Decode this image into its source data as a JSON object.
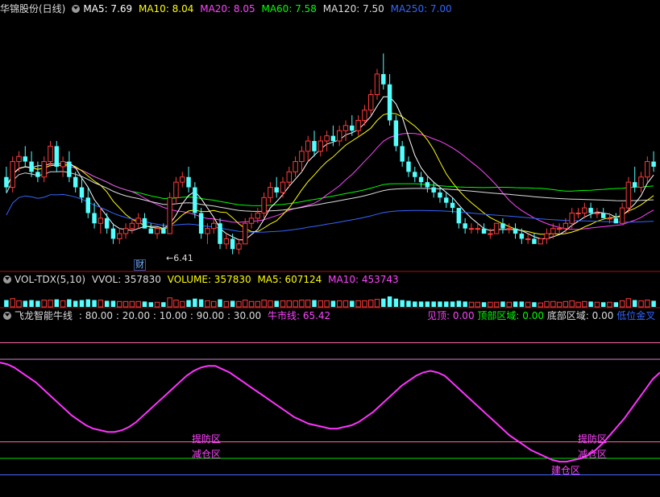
{
  "panel1": {
    "title": "华锦股份(日线)",
    "ma": [
      {
        "label": "MA5: 7.69",
        "color": "#ffffff"
      },
      {
        "label": "MA10: 8.04",
        "color": "#ffff00"
      },
      {
        "label": "MA20: 8.05",
        "color": "#ff44ff"
      },
      {
        "label": "MA60: 7.58",
        "color": "#00ff00"
      },
      {
        "label": "MA120: 7.50",
        "color": "#dddddd"
      },
      {
        "label": "MA250: 7.00",
        "color": "#3366ff"
      }
    ],
    "low_label": "6.41",
    "cai_label": "财"
  },
  "panel2": {
    "title": "VOL-TDX(5,10)",
    "items": [
      {
        "label": "VVOL: 357830",
        "color": "#dddddd"
      },
      {
        "label": "VOLUME: 357830",
        "color": "#ffff00"
      },
      {
        "label": "MA5: 607124",
        "color": "#ffff00"
      },
      {
        "label": "MA10: 453743",
        "color": "#ff44ff"
      }
    ]
  },
  "panel3": {
    "title": "飞龙智能牛线",
    "params": ": 80.00 : 20.00 : 10.00 : 90.00 : 30.00",
    "bull_label": "牛市线: 65.42",
    "right": [
      {
        "label": "见顶: 0.00",
        "color": "#ff44ff"
      },
      {
        "label": "顶部区域: 0.00",
        "color": "#00ff00"
      },
      {
        "label": "底部区域: 0.00",
        "color": "#dddddd"
      },
      {
        "label": "低位金叉",
        "color": "#3366ff"
      }
    ],
    "zone_labels": {
      "warn": "提防区",
      "hold": "减仓区",
      "build": "建仓区"
    }
  },
  "chart_data": {
    "type": "candlestick",
    "candles": [
      [
        7.9,
        8.1,
        7.6,
        7.7
      ],
      [
        7.7,
        8.3,
        7.6,
        8.2
      ],
      [
        8.2,
        8.4,
        8.0,
        8.3
      ],
      [
        8.3,
        8.5,
        8.1,
        8.2
      ],
      [
        8.2,
        8.4,
        7.9,
        8.0
      ],
      [
        8.0,
        8.2,
        7.8,
        7.9
      ],
      [
        7.9,
        8.3,
        7.8,
        8.2
      ],
      [
        8.2,
        8.6,
        8.1,
        8.5
      ],
      [
        8.5,
        8.6,
        8.0,
        8.1
      ],
      [
        8.1,
        8.3,
        7.9,
        8.2
      ],
      [
        8.2,
        8.4,
        7.8,
        7.9
      ],
      [
        7.9,
        8.0,
        7.6,
        7.7
      ],
      [
        7.7,
        7.9,
        7.4,
        7.5
      ],
      [
        7.5,
        7.7,
        7.1,
        7.2
      ],
      [
        7.2,
        7.4,
        6.9,
        7.0
      ],
      [
        7.0,
        7.3,
        6.8,
        7.1
      ],
      [
        7.1,
        7.2,
        6.8,
        6.9
      ],
      [
        6.9,
        7.0,
        6.6,
        6.7
      ],
      [
        6.7,
        6.9,
        6.6,
        6.8
      ],
      [
        6.8,
        7.0,
        6.7,
        6.9
      ],
      [
        6.9,
        7.1,
        6.8,
        7.0
      ],
      [
        7.0,
        7.2,
        6.9,
        7.1
      ],
      [
        7.1,
        7.2,
        6.9,
        6.9
      ],
      [
        6.9,
        7.0,
        6.8,
        6.8
      ],
      [
        6.8,
        6.9,
        6.7,
        6.9
      ],
      [
        6.9,
        7.0,
        6.8,
        6.8
      ],
      [
        6.8,
        7.6,
        6.8,
        7.5
      ],
      [
        7.5,
        7.9,
        7.4,
        7.8
      ],
      [
        7.8,
        8.0,
        7.7,
        7.9
      ],
      [
        7.9,
        8.1,
        7.6,
        7.7
      ],
      [
        7.7,
        7.8,
        7.1,
        7.2
      ],
      [
        7.2,
        7.3,
        6.7,
        6.8
      ],
      [
        6.8,
        7.0,
        6.6,
        6.9
      ],
      [
        6.9,
        7.1,
        6.8,
        7.0
      ],
      [
        7.0,
        7.1,
        6.5,
        6.6
      ],
      [
        6.6,
        6.8,
        6.5,
        6.7
      ],
      [
        6.7,
        6.8,
        6.4,
        6.5
      ],
      [
        6.5,
        6.7,
        6.4,
        6.6
      ],
      [
        6.6,
        7.1,
        6.6,
        7.0
      ],
      [
        7.0,
        7.2,
        6.9,
        7.1
      ],
      [
        7.1,
        7.3,
        7.0,
        7.2
      ],
      [
        7.2,
        7.6,
        7.1,
        7.5
      ],
      [
        7.5,
        7.8,
        7.4,
        7.7
      ],
      [
        7.7,
        7.9,
        7.5,
        7.6
      ],
      [
        7.6,
        7.9,
        7.5,
        7.8
      ],
      [
        7.8,
        8.1,
        7.7,
        8.0
      ],
      [
        8.0,
        8.3,
        7.9,
        8.2
      ],
      [
        8.2,
        8.5,
        8.0,
        8.4
      ],
      [
        8.4,
        8.7,
        8.2,
        8.6
      ],
      [
        8.6,
        8.8,
        8.3,
        8.4
      ],
      [
        8.4,
        8.7,
        8.3,
        8.6
      ],
      [
        8.6,
        8.8,
        8.4,
        8.7
      ],
      [
        8.7,
        8.9,
        8.5,
        8.6
      ],
      [
        8.6,
        8.9,
        8.5,
        8.8
      ],
      [
        8.8,
        9.0,
        8.6,
        8.9
      ],
      [
        8.9,
        9.1,
        8.7,
        8.8
      ],
      [
        8.8,
        9.1,
        8.7,
        9.0
      ],
      [
        9.0,
        9.3,
        8.9,
        9.2
      ],
      [
        9.2,
        9.6,
        9.1,
        9.5
      ],
      [
        9.5,
        10.0,
        9.4,
        9.9
      ],
      [
        9.9,
        10.3,
        9.6,
        9.7
      ],
      [
        9.7,
        9.9,
        8.9,
        9.0
      ],
      [
        9.0,
        9.1,
        8.4,
        8.5
      ],
      [
        8.5,
        8.6,
        8.1,
        8.2
      ],
      [
        8.2,
        8.3,
        7.9,
        8.0
      ],
      [
        8.0,
        8.1,
        7.8,
        7.9
      ],
      [
        7.9,
        8.0,
        7.7,
        7.8
      ],
      [
        7.8,
        7.9,
        7.6,
        7.7
      ],
      [
        7.7,
        7.8,
        7.5,
        7.6
      ],
      [
        7.6,
        7.7,
        7.4,
        7.5
      ],
      [
        7.5,
        7.6,
        7.3,
        7.4
      ],
      [
        7.4,
        7.5,
        7.2,
        7.3
      ],
      [
        7.3,
        7.3,
        6.9,
        7.0
      ],
      [
        7.0,
        7.1,
        6.8,
        6.9
      ],
      [
        6.9,
        7.0,
        6.8,
        6.9
      ],
      [
        6.9,
        7.0,
        6.8,
        6.9
      ],
      [
        6.9,
        7.0,
        6.8,
        6.8
      ],
      [
        6.8,
        6.9,
        6.7,
        6.8
      ],
      [
        6.8,
        7.0,
        6.8,
        7.0
      ],
      [
        7.0,
        7.1,
        6.8,
        6.9
      ],
      [
        6.9,
        7.0,
        6.8,
        6.9
      ],
      [
        6.9,
        7.0,
        6.7,
        6.8
      ],
      [
        6.8,
        6.9,
        6.6,
        6.7
      ],
      [
        6.7,
        6.8,
        6.6,
        6.7
      ],
      [
        6.7,
        6.8,
        6.6,
        6.6
      ],
      [
        6.6,
        6.7,
        6.6,
        6.7
      ],
      [
        6.7,
        6.9,
        6.6,
        6.8
      ],
      [
        6.8,
        7.0,
        6.7,
        6.9
      ],
      [
        6.9,
        7.0,
        6.8,
        6.9
      ],
      [
        6.9,
        7.1,
        6.8,
        7.0
      ],
      [
        7.0,
        7.3,
        6.9,
        7.2
      ],
      [
        7.2,
        7.3,
        7.1,
        7.2
      ],
      [
        7.2,
        7.4,
        7.1,
        7.3
      ],
      [
        7.3,
        7.4,
        7.1,
        7.2
      ],
      [
        7.2,
        7.3,
        7.1,
        7.2
      ],
      [
        7.2,
        7.3,
        7.1,
        7.1
      ],
      [
        7.1,
        7.2,
        7.0,
        7.1
      ],
      [
        7.1,
        7.2,
        7.0,
        7.0
      ],
      [
        7.0,
        7.4,
        7.0,
        7.3
      ],
      [
        7.3,
        7.9,
        7.2,
        7.8
      ],
      [
        7.8,
        8.1,
        7.6,
        7.7
      ],
      [
        7.7,
        8.0,
        7.6,
        7.9
      ],
      [
        7.9,
        8.3,
        7.8,
        8.2
      ],
      [
        8.2,
        8.4,
        8.0,
        8.1
      ]
    ],
    "oscillator": {
      "levels": [
        90,
        80,
        30,
        20,
        10
      ],
      "values": [
        78,
        77,
        75,
        72,
        69,
        66,
        62,
        58,
        54,
        50,
        46,
        43,
        40,
        38,
        37,
        36,
        36,
        37,
        39,
        42,
        46,
        50,
        54,
        58,
        62,
        66,
        70,
        73,
        75,
        76,
        76,
        74,
        72,
        69,
        66,
        63,
        60,
        57,
        54,
        51,
        48,
        45,
        43,
        41,
        40,
        39,
        38,
        38,
        39,
        40,
        42,
        45,
        48,
        52,
        56,
        60,
        64,
        67,
        70,
        72,
        73,
        72,
        70,
        66,
        62,
        58,
        54,
        50,
        46,
        42,
        38,
        34,
        31,
        28,
        25,
        23,
        21,
        19,
        18,
        18,
        19,
        20,
        22,
        25,
        29,
        34,
        39,
        44,
        50,
        56,
        62,
        68,
        72
      ]
    }
  }
}
